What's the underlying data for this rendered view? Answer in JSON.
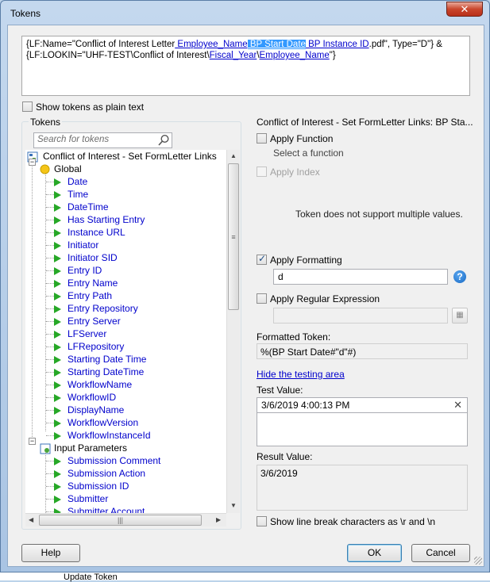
{
  "window": {
    "title": "Tokens",
    "close_label": "✕"
  },
  "expression": {
    "line1_prefix": "{LF:Name=\"Conflict of Interest Letter",
    "line1_tok1": " Employee_Name",
    "line1_tok2": " BP Start Date",
    "line1_tok3": " BP Instance ID",
    "line1_suffix": ".pdf\", Type=\"D\"} &",
    "line2_prefix": "{LF:LOOKIN=\"UHF-TEST\\Conflict of Interest\\",
    "line2_tok1": "Fiscal_Year",
    "line2_sep": "\\",
    "line2_tok2": "Employee_Name",
    "line2_suffix": "\"}"
  },
  "show_plain_label": "Show tokens as plain text",
  "tokens_panel": {
    "title": "Tokens",
    "search_placeholder": "Search for tokens",
    "root": "Conflict of Interest - Set FormLetter Links",
    "global_label": "Global",
    "global_items": [
      "Date",
      "Time",
      "DateTime",
      "Has Starting Entry",
      "Instance URL",
      "Initiator",
      "Initiator SID",
      "Entry ID",
      "Entry Name",
      "Entry Path",
      "Entry Repository",
      "Entry Server",
      "LFServer",
      "LFRepository",
      "Starting Date Time",
      "Starting DateTime",
      "WorkflowName",
      "WorkflowID",
      "DisplayName",
      "WorkflowVersion",
      "WorkflowInstanceId"
    ],
    "input_label": "Input Parameters",
    "input_items": [
      "Submission Comment",
      "Submission Action",
      "Submission ID",
      "Submitter",
      "Submitter Account"
    ]
  },
  "right_panel": {
    "title": "Conflict of Interest - Set FormLetter Links: BP Sta...",
    "apply_function": "Apply Function",
    "select_function": "Select a function",
    "apply_index": "Apply Index",
    "no_multi": "Token does not support multiple values.",
    "apply_formatting": "Apply Formatting",
    "format_value": "d",
    "apply_regex": "Apply Regular Expression",
    "formatted_token_label": "Formatted Token:",
    "formatted_token": "%(BP Start Date#\"d\"#)",
    "hide_testing": "Hide the testing area",
    "test_value_label": "Test Value:",
    "test_value": "3/6/2019 4:00:13 PM",
    "result_value_label": "Result Value:",
    "result_value": "3/6/2019",
    "line_break_label": "Show line break characters as \\r and \\n"
  },
  "buttons": {
    "help": "Help",
    "ok": "OK",
    "cancel": "Cancel"
  },
  "behind_text": "Update Token"
}
